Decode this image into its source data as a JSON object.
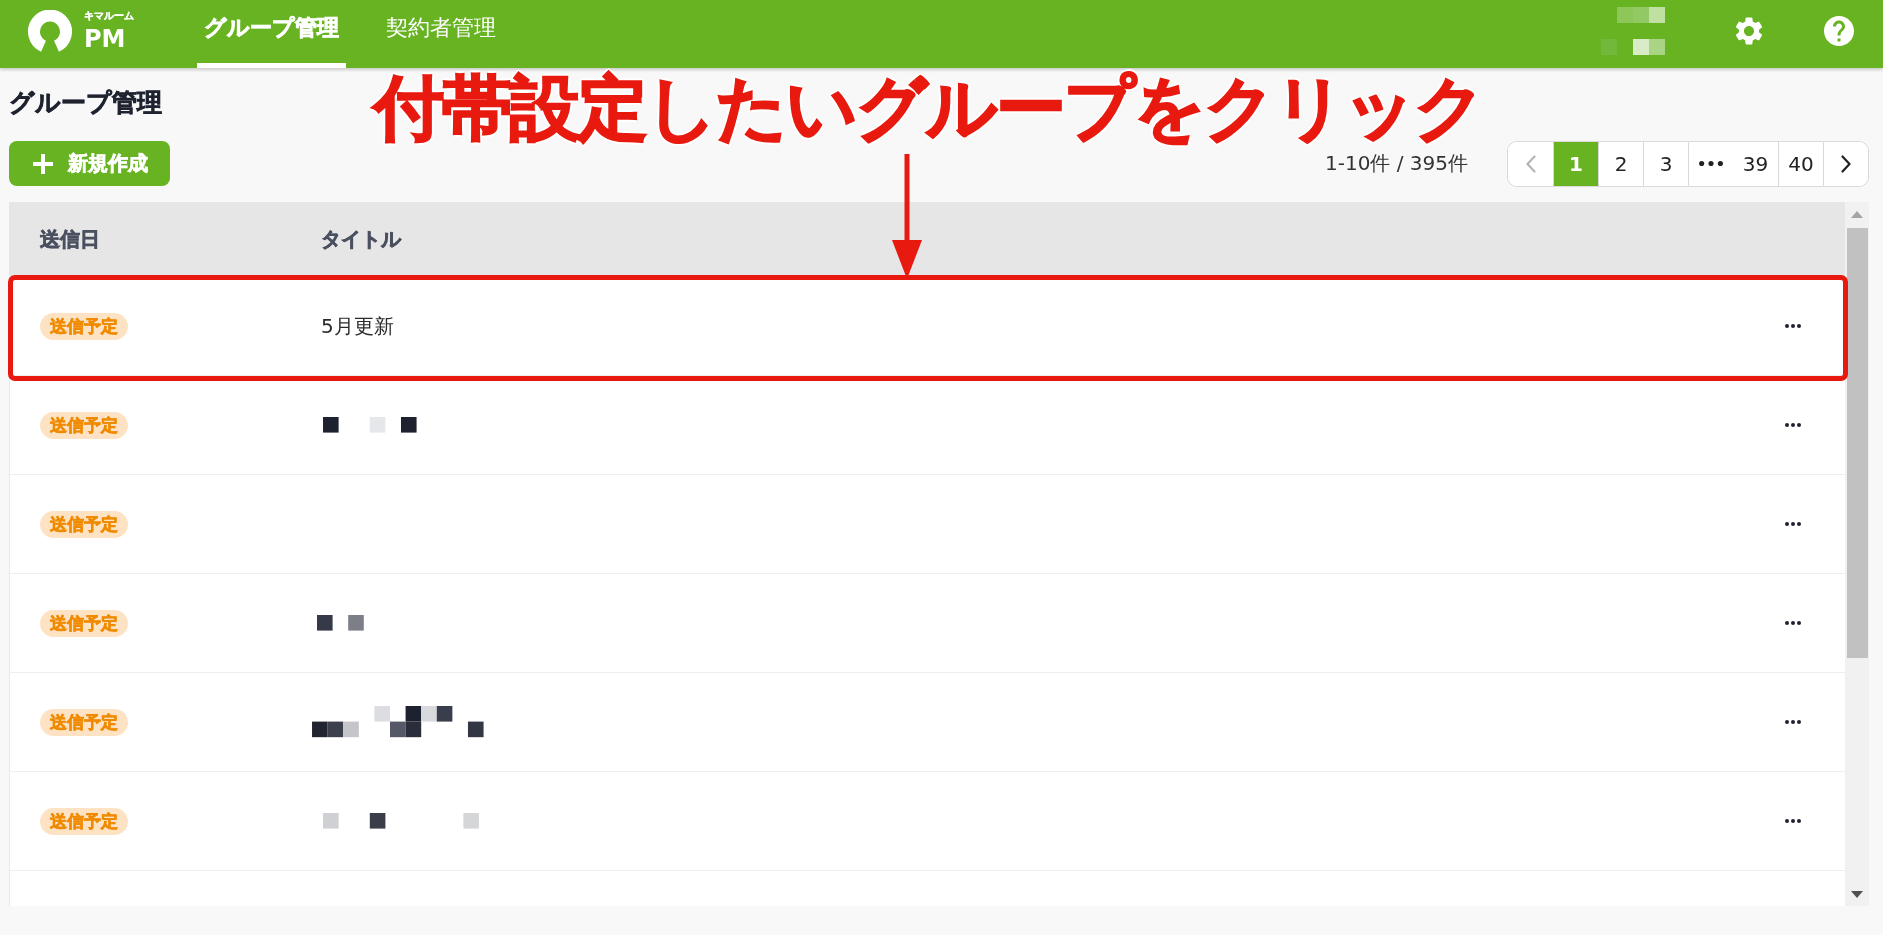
{
  "header": {
    "logo": {
      "subtitle": "キマルーム",
      "title": "PM"
    },
    "tabs": [
      {
        "label": "グループ管理",
        "selected": true
      },
      {
        "label": "契約者管理",
        "selected": false
      }
    ],
    "account_name_pixelated": true
  },
  "page": {
    "title": "グループ管理",
    "create_button": {
      "label": "新規作成"
    },
    "count": "1-10件 / 395件"
  },
  "pagination": {
    "items": [
      {
        "kind": "prev",
        "disabled": true
      },
      {
        "kind": "page",
        "label": "1",
        "selected": true
      },
      {
        "kind": "page",
        "label": "2",
        "selected": false
      },
      {
        "kind": "page",
        "label": "3",
        "selected": false
      },
      {
        "kind": "ellipsis"
      },
      {
        "kind": "page",
        "label": "39",
        "selected": false
      },
      {
        "kind": "page",
        "label": "40",
        "selected": false
      },
      {
        "kind": "next",
        "disabled": false
      }
    ]
  },
  "table": {
    "columns": [
      "送信日",
      "タイトル"
    ],
    "rows": [
      {
        "status": "送信予定",
        "title": "5月更新",
        "title_pixelated": false,
        "highlighted": true
      },
      {
        "status": "送信予定",
        "title_pixelated": true,
        "highlighted": false
      },
      {
        "status": "送信予定",
        "title_pixelated": false,
        "highlighted": false
      },
      {
        "status": "送信予定",
        "title_pixelated": true,
        "highlighted": false
      },
      {
        "status": "送信予定",
        "title_pixelated": true,
        "highlighted": false
      },
      {
        "status": "送信予定",
        "title_pixelated": true,
        "highlighted": false
      }
    ]
  },
  "annotation": {
    "text": "付帯設定したいグループをクリック"
  }
}
